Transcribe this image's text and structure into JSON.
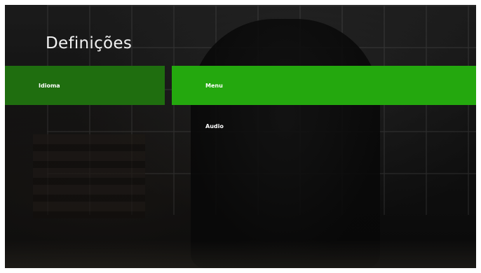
{
  "header": {
    "title": "Definições"
  },
  "left_menu": {
    "items": [
      {
        "label": "Idioma"
      }
    ]
  },
  "right_menu": {
    "items": [
      {
        "label": "Menu"
      },
      {
        "label": "Audio"
      }
    ]
  },
  "colors": {
    "left_selected": "#1f6e0f",
    "right_selected": "#24a80e"
  }
}
